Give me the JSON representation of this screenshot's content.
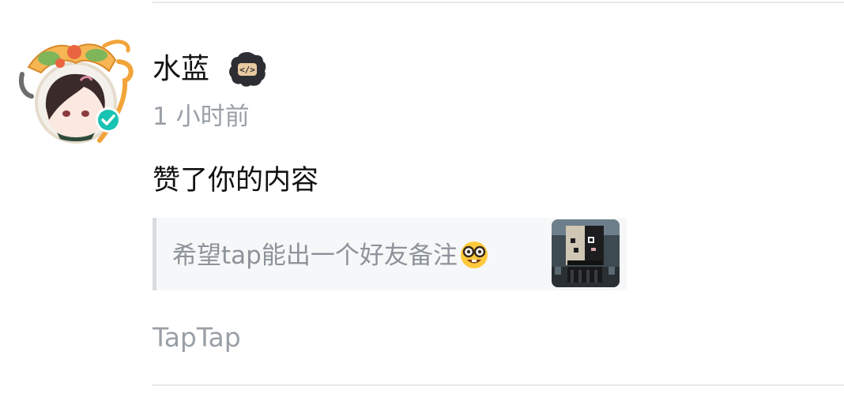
{
  "notification": {
    "user": {
      "name": "水蓝",
      "avatar_icon": "anime-character-avatar-icon",
      "verified_icon": "verified-check-icon",
      "badge_icon": "developer-code-badge-icon"
    },
    "time": "1 小时前",
    "action": "赞了你的内容",
    "quote": {
      "text": "希望tap能出一个好友备注",
      "emoji": "nerd-face-emoji",
      "thumbnail": "pixel-art-thumbnail"
    },
    "source": "TapTap"
  },
  "colors": {
    "primary_text": "#111214",
    "secondary_text": "#9aa0a6",
    "quote_bg": "#f6f7f8",
    "quote_border": "#d9dcdf",
    "verified": "#17c3b2"
  }
}
